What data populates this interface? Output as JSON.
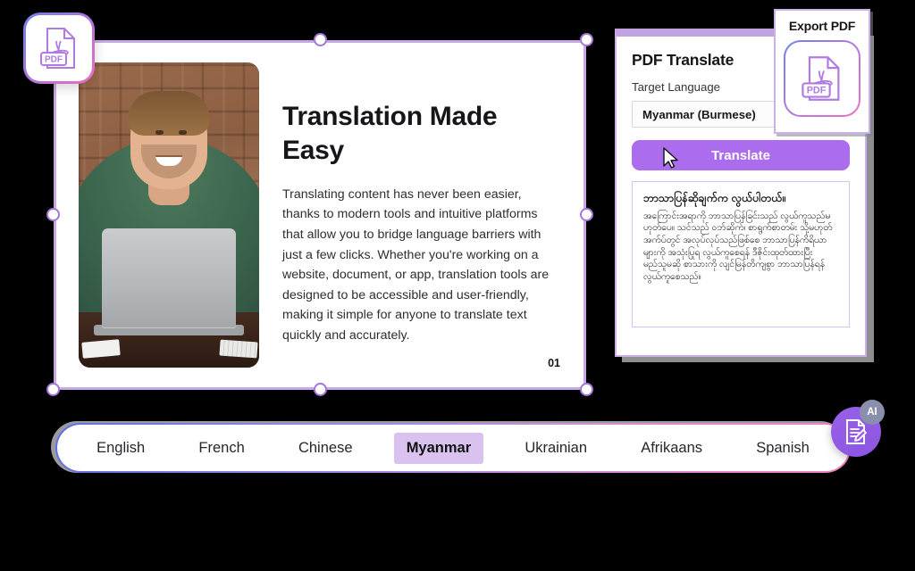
{
  "pdf_float": {
    "icon": "pdf-file-icon",
    "badge_label": "PDF"
  },
  "slide": {
    "title": "Translation Made Easy",
    "body": "Translating content has never been easier, thanks to modern tools and intuitive platforms that allow you to bridge language barriers with just a few clicks. Whether you're working on a website, document, or app, translation tools are designed to be accessible and user-friendly, making it simple for anyone to translate text quickly and accurately.",
    "page_number": "01",
    "photo_alt": "man-at-laptop-photo"
  },
  "right_panel": {
    "title": "PDF Translate",
    "target_language_label": "Target Language",
    "selected_language": "Myanmar (Burmese)",
    "translate_button": "Translate",
    "output_title": "ဘာသာပြန်ဆိုချက်က လွယ်ပါတယ်။",
    "output_body": "အကြောင်းအရာကို ဘာသာပြန်ခြင်းသည် လွယ်ကူသည်မဟုတ်ပေ။ သင်သည် ဝဘ်ဆိုက်၊ စာရွက်စာတမ်း သို့မဟုတ် အက်ပ်တွင် အလုပ်လုပ်သည်ဖြစ်စေ ဘာသာပြန်ကိရိယာများကို အသုံးပြုရ လွယ်ကူစေရန် ဒီဇိုင်းထုတ်ထားပြီး မည်သူမဆို စာသားကို လျင်မြန်တိကျစွာ ဘာသာပြန်ရန် လွယ်ကူစေသည်။"
  },
  "export_card": {
    "title": "Export PDF",
    "icon": "pdf-file-icon",
    "badge_label": "PDF"
  },
  "language_bar": {
    "items": [
      {
        "label": "English",
        "active": false
      },
      {
        "label": "French",
        "active": false
      },
      {
        "label": "Chinese",
        "active": false
      },
      {
        "label": "Myanmar",
        "active": true
      },
      {
        "label": "Ukrainian",
        "active": false
      },
      {
        "label": "Afrikaans",
        "active": false
      },
      {
        "label": "Spanish",
        "active": false
      }
    ]
  },
  "ai_fab": {
    "icon": "document-edit-icon",
    "badge": "AI"
  },
  "colors": {
    "accent_purple": "#ab6ced",
    "selection_border": "#c8a9e6",
    "active_tab_bg": "#d9c2f0",
    "gradient_start": "#5f6fe0",
    "gradient_end": "#f47fc0"
  }
}
